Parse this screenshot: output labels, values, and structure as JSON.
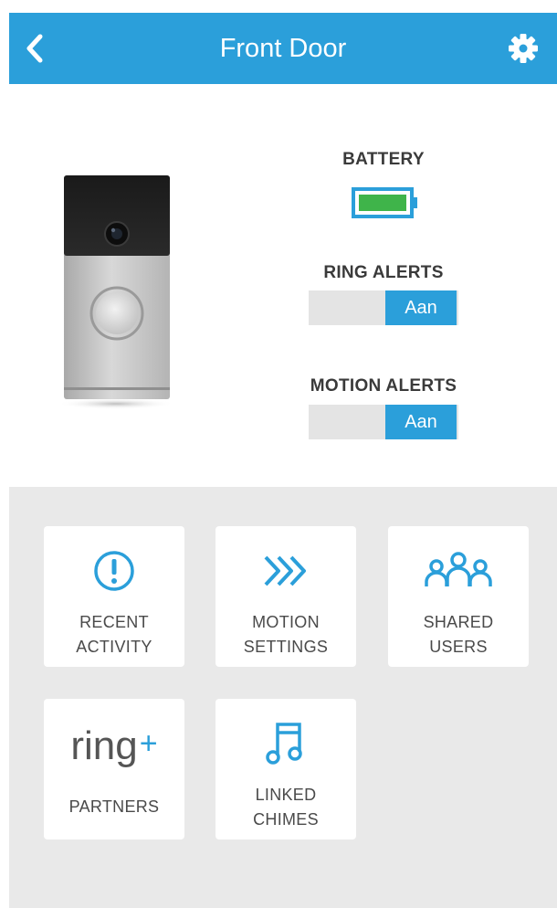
{
  "header": {
    "title": "Front Door",
    "background": "#2b9fda"
  },
  "status": {
    "battery_label": "BATTERY",
    "battery_color": "#3fb44a",
    "ring_alerts_label": "RING ALERTS",
    "ring_alerts_value": "Aan",
    "motion_alerts_label": "MOTION ALERTS",
    "motion_alerts_value": "Aan"
  },
  "tiles": [
    {
      "icon": "alert-circle-icon",
      "line1": "RECENT",
      "line2": "ACTIVITY"
    },
    {
      "icon": "motion-chevrons-icon",
      "line1": "MOTION",
      "line2": "SETTINGS"
    },
    {
      "icon": "users-group-icon",
      "line1": "SHARED",
      "line2": "USERS"
    },
    {
      "icon": "ring-plus-logo",
      "logo_text": "ring",
      "logo_plus": "+",
      "line1": "PARTNERS"
    },
    {
      "icon": "music-note-icon",
      "line1": "LINKED",
      "line2": "CHIMES"
    }
  ]
}
